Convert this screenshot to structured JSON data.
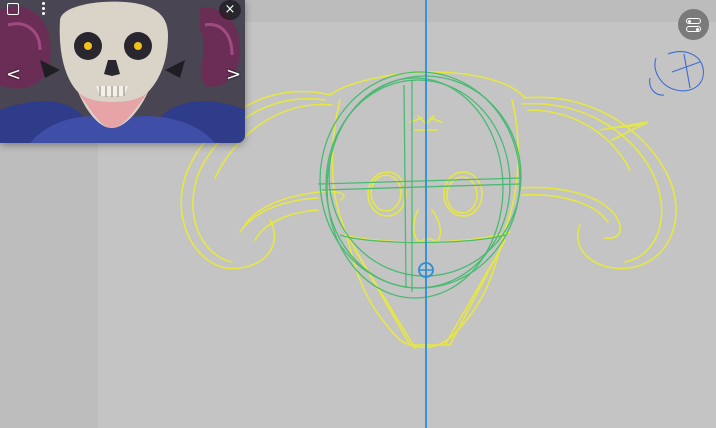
{
  "canvas": {
    "background": "#c4c4c4",
    "sketch_colors": {
      "yellow": "#e8ea3a",
      "green": "#3dba6a",
      "guide": "#2b8fd6",
      "note": "#3f6bd0"
    }
  },
  "reference_window": {
    "prev_label": "<",
    "next_label": ">",
    "close_label": "×",
    "icons": {
      "window": "square-icon",
      "menu": "more-vertical-icon",
      "close": "close-icon"
    }
  },
  "toolbar": {
    "toggle_icon": "toggle-settings-icon"
  }
}
